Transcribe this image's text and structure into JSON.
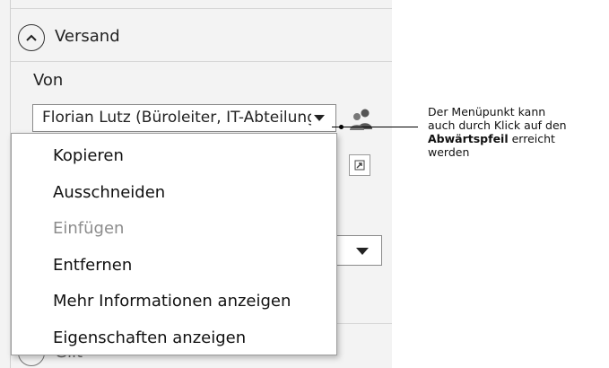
{
  "section": {
    "title": "Versand",
    "toggle_icon": "chevron-up-circle-icon"
  },
  "from": {
    "label": "Von",
    "value": "Florian Lutz (Büroleiter, IT-Abteilung)"
  },
  "context_menu": {
    "items": [
      {
        "label": "Kopieren",
        "enabled": true
      },
      {
        "label": "Ausschneiden",
        "enabled": true
      },
      {
        "label": "Einfügen",
        "enabled": false
      },
      {
        "label": "Entfernen",
        "enabled": true
      },
      {
        "label": "Mehr Informationen anzeigen",
        "enabled": true
      },
      {
        "label": "Eigenschaften anzeigen",
        "enabled": true
      }
    ]
  },
  "hidden_row": {
    "text": "Gilt"
  },
  "callout": {
    "line1": "Der Menüpunkt kann",
    "line2": "auch durch Klick auf den",
    "bold": "Abwärtspfeil",
    "line3_rest": " erreicht",
    "line4": "werden"
  },
  "colors": {
    "panel_bg": "#f3f3f3",
    "disabled_text": "#8c8c8c"
  }
}
